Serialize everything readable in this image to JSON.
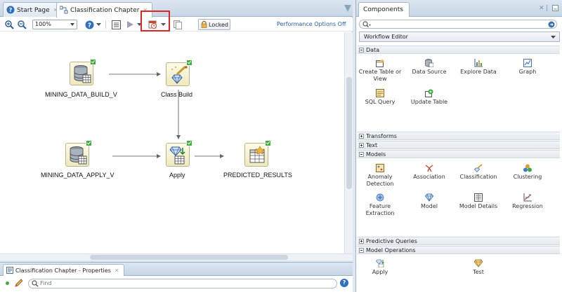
{
  "editor": {
    "tabs": [
      {
        "label": "Start Page",
        "icon": "help-circle-icon"
      },
      {
        "label": "Classification Chapter",
        "icon": "workflow-icon",
        "active": true
      }
    ]
  },
  "toolbar": {
    "zoom_value": "100%",
    "locked_label": "Locked",
    "performance_link": "Performance Options Off"
  },
  "workflow": {
    "nodes": [
      {
        "id": "build",
        "label": "MINING_DATA_BUILD_V",
        "icon": "data-source-icon"
      },
      {
        "id": "classbuild",
        "label": "Class Build",
        "icon": "classification-build-icon"
      },
      {
        "id": "apply_src",
        "label": "MINING_DATA_APPLY_V",
        "icon": "data-source-icon"
      },
      {
        "id": "apply",
        "label": "Apply",
        "icon": "apply-icon"
      },
      {
        "id": "results",
        "label": "PREDICTED_RESULTS",
        "icon": "create-table-icon"
      }
    ]
  },
  "properties": {
    "tab_label": "Classification Chapter - Properties",
    "find_placeholder": "Find"
  },
  "components": {
    "title": "Components",
    "palette": "Workflow Editor",
    "sections": {
      "data": {
        "label": "Data",
        "items": [
          "Create Table or View",
          "Data Source",
          "Explore Data",
          "Graph",
          "SQL Query",
          "Update Table"
        ]
      },
      "transforms": {
        "label": "Transforms"
      },
      "text": {
        "label": "Text"
      },
      "models": {
        "label": "Models",
        "items": [
          "Anomaly Detection",
          "Association",
          "Classification",
          "Clustering",
          "Feature Extraction",
          "Model",
          "Model Details",
          "Regression"
        ]
      },
      "predictive_queries": {
        "label": "Predictive Queries"
      },
      "model_operations": {
        "label": "Model Operations",
        "items": [
          "Apply",
          "Test"
        ]
      }
    }
  },
  "colors": {
    "accent": "#2f6fc0",
    "highlight": "#e02424",
    "check": "#3fae3f"
  }
}
